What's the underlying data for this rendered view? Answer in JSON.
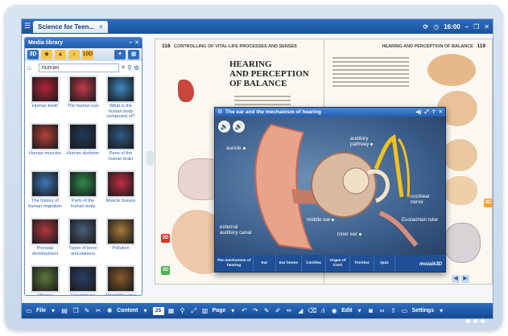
{
  "app": {
    "document_tab": "Science for Teen...",
    "clock": "16:00",
    "colors": {
      "bar": "#1f5ba8",
      "accent": "#f5c84b",
      "ear_tabs": "#1f4f96"
    }
  },
  "media_library": {
    "title": "Media library",
    "search_value": "human",
    "tool_labels": [
      "3D",
      "10D"
    ],
    "items": [
      {
        "label": "Human teeth",
        "color": "#b8213a"
      },
      {
        "label": "The human eye",
        "color": "#c43a4a"
      },
      {
        "label": "What is the human body composed of?",
        "color": "#3b88c4"
      },
      {
        "label": "Human muscles",
        "color": "#b8403a"
      },
      {
        "label": "Human skeleton",
        "color": "#1f3a58"
      },
      {
        "label": "Parts of the human brain",
        "color": "#2e5a86"
      },
      {
        "label": "The history of human migration",
        "color": "#3b78b8"
      },
      {
        "label": "Parts of the human body",
        "color": "#2f8a4a"
      },
      {
        "label": "Muscle tissues",
        "color": "#c42c46"
      },
      {
        "label": "Prenatal development",
        "color": "#b2383e"
      },
      {
        "label": "Types of bone articulations",
        "color": "#4b5f78"
      },
      {
        "label": "Pollution",
        "color": "#a77a3a"
      },
      {
        "label": "Villages",
        "color": "#5b7a3a"
      },
      {
        "label": "Greenhouse effect",
        "color": "#2a3f6a"
      },
      {
        "label": "Megalithic sites",
        "color": "#8a5a2a"
      }
    ]
  },
  "book": {
    "left_page_number": "118",
    "left_header": "CONTROLLING OF VITAL LIFE PROCESSES AND SENSES",
    "right_page_number": "119",
    "right_header": "HEARING AND PERCEPTION OF BALANCE",
    "title_line1": "HEARING",
    "title_line2": "AND PERCEPTION",
    "title_line3": "OF BALANCE",
    "badge_3d": "3D"
  },
  "ear_window": {
    "title": "The ear and the mechanism of hearing",
    "labels": {
      "auricle": "auricle",
      "auditory_pathway": "auditory pathway",
      "cochlear_nerve": "cochlear nerve",
      "eustachian_tube": "Eustachian tube",
      "middle_ear": "middle ear",
      "inner_ear": "inner ear",
      "external_canal": "external auditory canal"
    },
    "tabs": [
      "The mechanism of hearing",
      "Ear",
      "Ear bones",
      "Cochlea",
      "Organ of Corti",
      "Tinnitus",
      "Quiz"
    ],
    "brand": "mozaik3D"
  },
  "bottom_bar": {
    "file_label": "File",
    "content_label": "Content",
    "page_value": "25",
    "page_label": "Page",
    "edit_label": "Edit",
    "settings_label": "Settings"
  }
}
